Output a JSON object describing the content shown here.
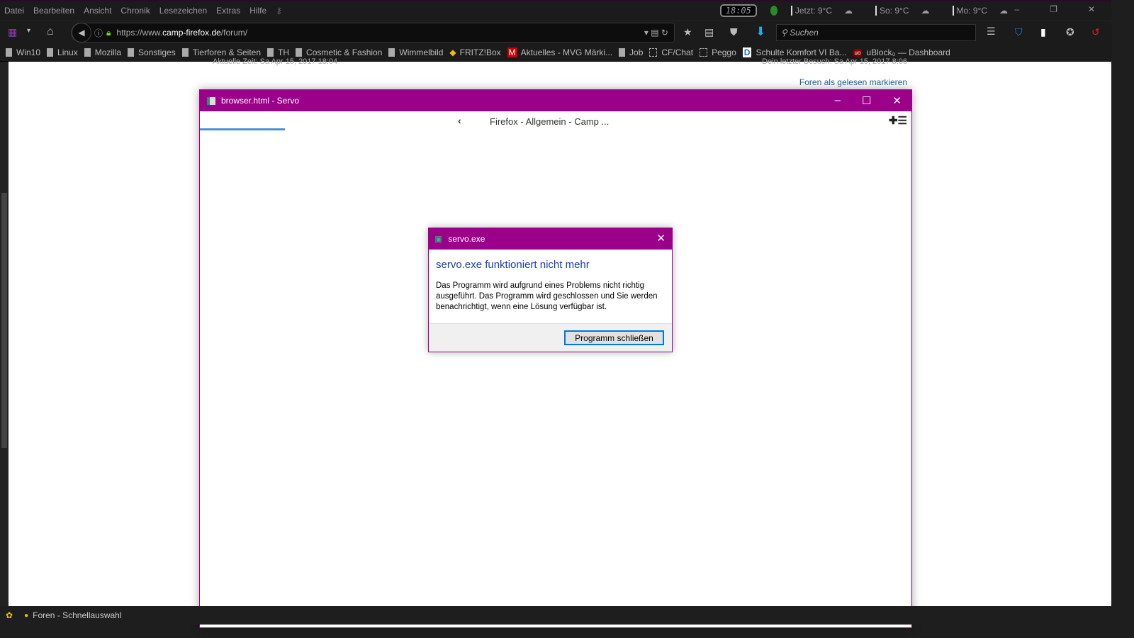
{
  "menu": [
    "Datei",
    "Bearbeiten",
    "Ansicht",
    "Chronik",
    "Lesezeichen",
    "Extras",
    "Hilfe"
  ],
  "status": {
    "clock": "18:05",
    "weather": [
      "Jetzt: 9°C",
      "So: 9°C",
      "Mo: 9°C"
    ]
  },
  "nav": {
    "url_prefix": "https://www.",
    "url_domain": "camp-firefox.de",
    "url_path": "/forum/",
    "search_placeholder": "Suchen"
  },
  "bookmarks": [
    "Win10",
    "Linux",
    "Mozilla",
    "Sonstiges",
    "Tierforen & Seiten",
    "TH",
    "Cosmetic & Fashion",
    "Wimmelbild",
    "FRITZ!Box",
    "Aktuelles - MVG Märki...",
    "Job",
    "CF/Chat",
    "Peggo",
    "Schulte Komfort VI Ba...",
    "uBlock₀ — Dashboard"
  ],
  "page": {
    "left_faded": "Aktuelle Zeit: Sa Apr 15, 2017 18:04",
    "right_faded": "Dein letzter Besuch: Sa Apr 15, 2017 8:06",
    "mark_read": "Foren als gelesen markieren"
  },
  "servo": {
    "title": "browser.html - Servo",
    "tab_title": "Firefox - Allgemein - Camp ...",
    "progress": 0.12
  },
  "dialog": {
    "title": "servo.exe",
    "heading": "servo.exe funktioniert nicht mehr",
    "message": "Das Programm wird aufgrund eines Problems nicht richtig ausgeführt. Das Programm wird geschlossen und Sie werden benachrichtigt, wenn eine Lösung verfügbar ist.",
    "button": "Programm schließen"
  },
  "statusbar": {
    "text": "Foren - Schnellauswahl"
  }
}
